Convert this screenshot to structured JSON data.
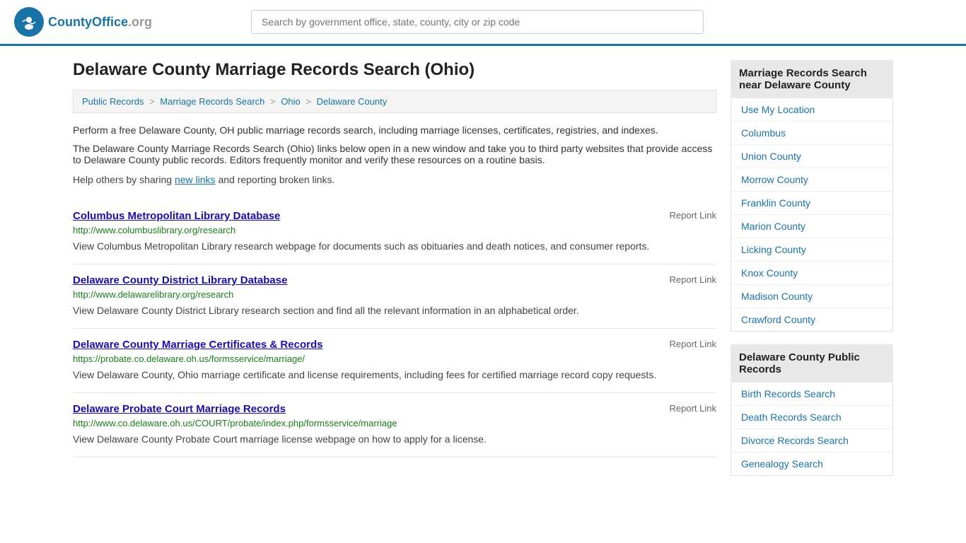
{
  "header": {
    "logo_text": "CountyOffice",
    "logo_tld": ".org",
    "search_placeholder": "Search by government office, state, county, city or zip code"
  },
  "page": {
    "title": "Delaware County Marriage Records Search (Ohio)",
    "breadcrumb": [
      {
        "label": "Public Records",
        "href": "#"
      },
      {
        "label": "Marriage Records Search",
        "href": "#"
      },
      {
        "label": "Ohio",
        "href": "#"
      },
      {
        "label": "Delaware County",
        "href": "#"
      }
    ],
    "intro1": "Perform a free Delaware County, OH public marriage records search, including marriage licenses, certificates, registries, and indexes.",
    "intro2": "The Delaware County Marriage Records Search (Ohio) links below open in a new window and take you to third party websites that provide access to Delaware County public records. Editors frequently monitor and verify these resources on a routine basis.",
    "sharing_text_before": "Help others by sharing ",
    "sharing_link_label": "new links",
    "sharing_text_after": " and reporting broken links."
  },
  "records": [
    {
      "title": "Columbus Metropolitan Library Database",
      "url": "http://www.columbuslibrary.org/research",
      "description": "View Columbus Metropolitan Library research webpage for documents such as obituaries and death notices, and consumer reports.",
      "report_label": "Report Link"
    },
    {
      "title": "Delaware County District Library Database",
      "url": "http://www.delawarelibrary.org/research",
      "description": "View Delaware County District Library research section and find all the relevant information in an alphabetical order.",
      "report_label": "Report Link"
    },
    {
      "title": "Delaware County Marriage Certificates & Records",
      "url": "https://probate.co.delaware.oh.us/formsservice/marriage/",
      "description": "View Delaware County, Ohio marriage certificate and license requirements, including fees for certified marriage record copy requests.",
      "report_label": "Report Link"
    },
    {
      "title": "Delaware Probate Court Marriage Records",
      "url": "http://www.co.delaware.oh.us/COURT/probate/index.php/formsservice/marriage",
      "description": "View Delaware County Probate Court marriage license webpage on how to apply for a license.",
      "report_label": "Report Link"
    }
  ],
  "sidebar": {
    "nearby_section_title": "Marriage Records Search near Delaware County",
    "nearby_links": [
      {
        "label": "Use My Location",
        "href": "#"
      },
      {
        "label": "Columbus",
        "href": "#"
      },
      {
        "label": "Union County",
        "href": "#"
      },
      {
        "label": "Morrow County",
        "href": "#"
      },
      {
        "label": "Franklin County",
        "href": "#"
      },
      {
        "label": "Marion County",
        "href": "#"
      },
      {
        "label": "Licking County",
        "href": "#"
      },
      {
        "label": "Knox County",
        "href": "#"
      },
      {
        "label": "Madison County",
        "href": "#"
      },
      {
        "label": "Crawford County",
        "href": "#"
      }
    ],
    "public_records_section_title": "Delaware County Public Records",
    "public_records_links": [
      {
        "label": "Birth Records Search",
        "href": "#"
      },
      {
        "label": "Death Records Search",
        "href": "#"
      },
      {
        "label": "Divorce Records Search",
        "href": "#"
      },
      {
        "label": "Genealogy Search",
        "href": "#"
      }
    ]
  }
}
